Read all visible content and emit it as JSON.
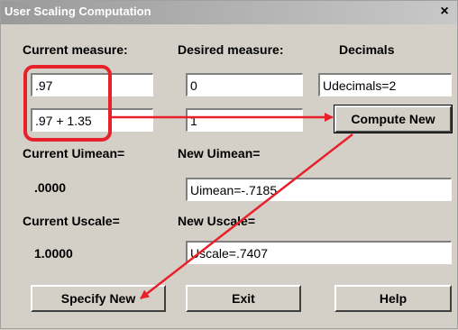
{
  "window": {
    "title": "User Scaling Computation",
    "close_glyph": "×"
  },
  "headers": {
    "current": "Current measure:",
    "desired": "Desired measure:",
    "decimals": "Decimals"
  },
  "fields": {
    "current1": ".97",
    "current2": ".97 + 1.35",
    "desired1": "0",
    "desired2": "1",
    "decimals": "Udecimals=2",
    "new_uimean": "Uimean=-.7185",
    "new_uscale": "Uscale=.7407"
  },
  "labels": {
    "current_uimean": "Current Uimean=",
    "new_uimean": "New Uimean=",
    "current_uscale": "Current Uscale=",
    "new_uscale": "New Uscale="
  },
  "values": {
    "current_uimean": ".0000",
    "current_uscale": "1.0000"
  },
  "buttons": {
    "compute": "Compute New",
    "specify": "Specify New",
    "exit": "Exit",
    "help": "Help"
  },
  "colors": {
    "annotation": "#e8202a"
  }
}
